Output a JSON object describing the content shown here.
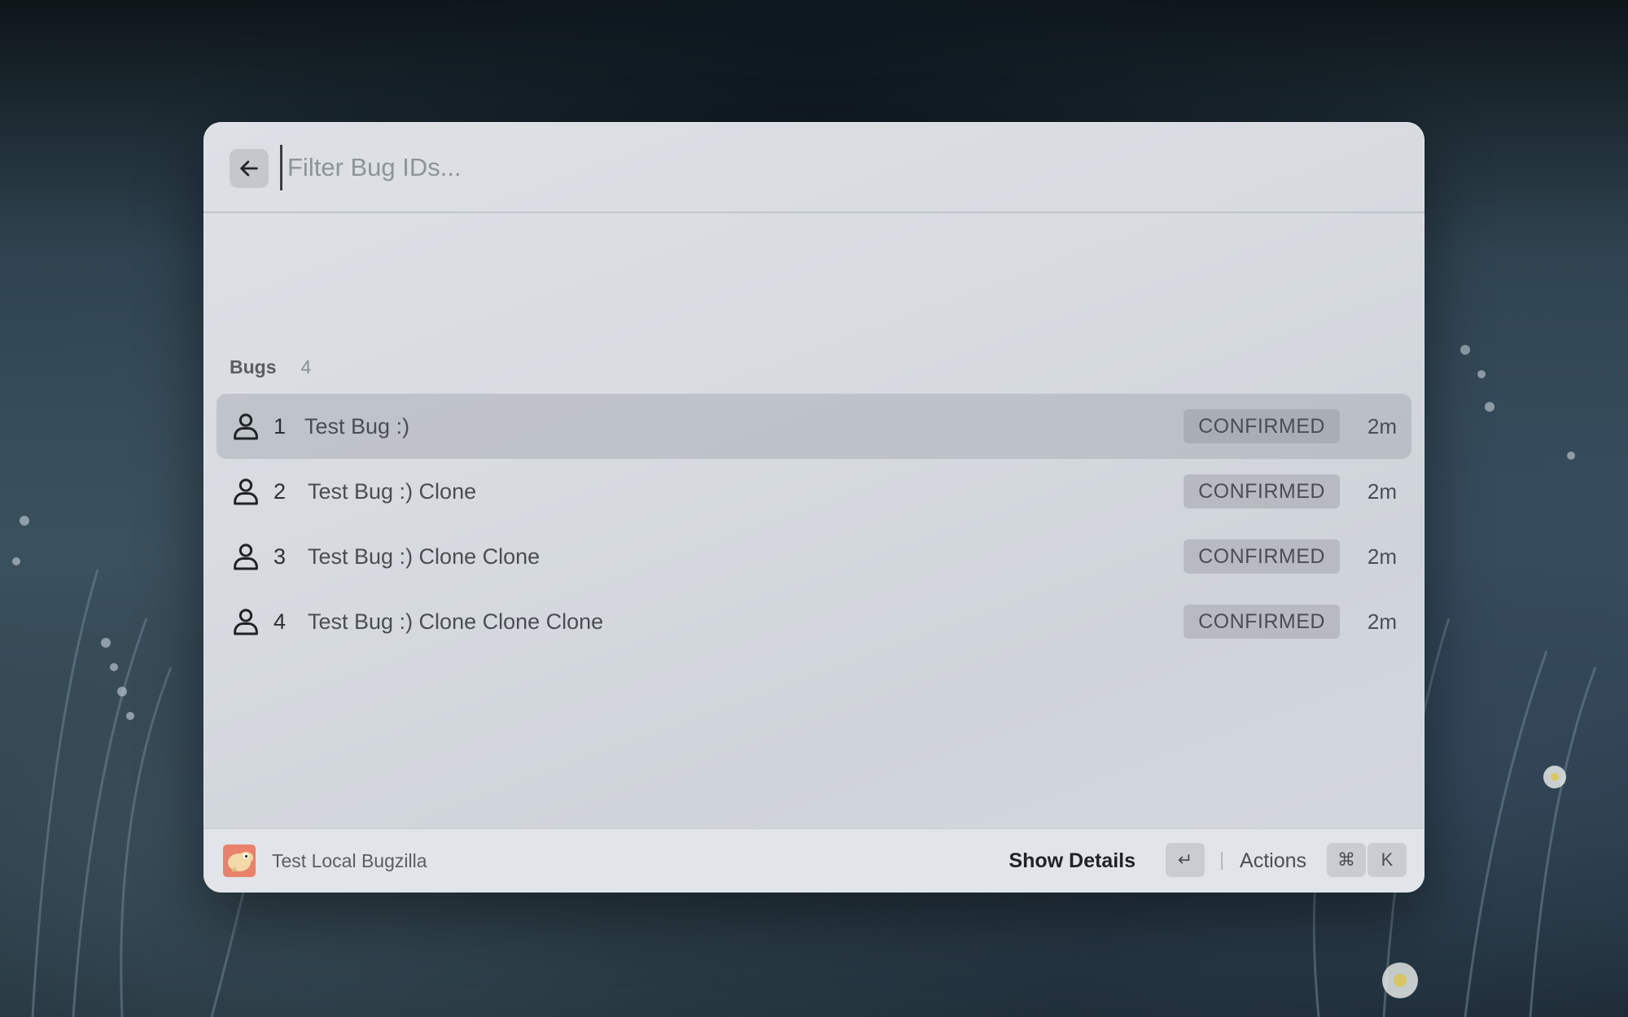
{
  "search": {
    "placeholder": "Filter Bug IDs..."
  },
  "section": {
    "title": "Bugs",
    "count": "4"
  },
  "bugs": [
    {
      "id": "1",
      "title": "Test Bug :)",
      "status": "CONFIRMED",
      "age": "2m",
      "selected": true
    },
    {
      "id": "2",
      "title": "Test Bug :) Clone",
      "status": "CONFIRMED",
      "age": "2m",
      "selected": false
    },
    {
      "id": "3",
      "title": "Test Bug :) Clone Clone",
      "status": "CONFIRMED",
      "age": "2m",
      "selected": false
    },
    {
      "id": "4",
      "title": "Test Bug :) Clone Clone Clone",
      "status": "CONFIRMED",
      "age": "2m",
      "selected": false
    }
  ],
  "footer": {
    "app_name": "Test Local Bugzilla",
    "primary_action": "Show Details",
    "primary_shortcut": "↵",
    "actions_label": "Actions",
    "actions_shortcut_modifier": "⌘",
    "actions_shortcut_key": "K"
  },
  "icons": {
    "back": "arrow-left-icon",
    "row": "person-icon",
    "app": "bugzilla-logo-icon"
  }
}
